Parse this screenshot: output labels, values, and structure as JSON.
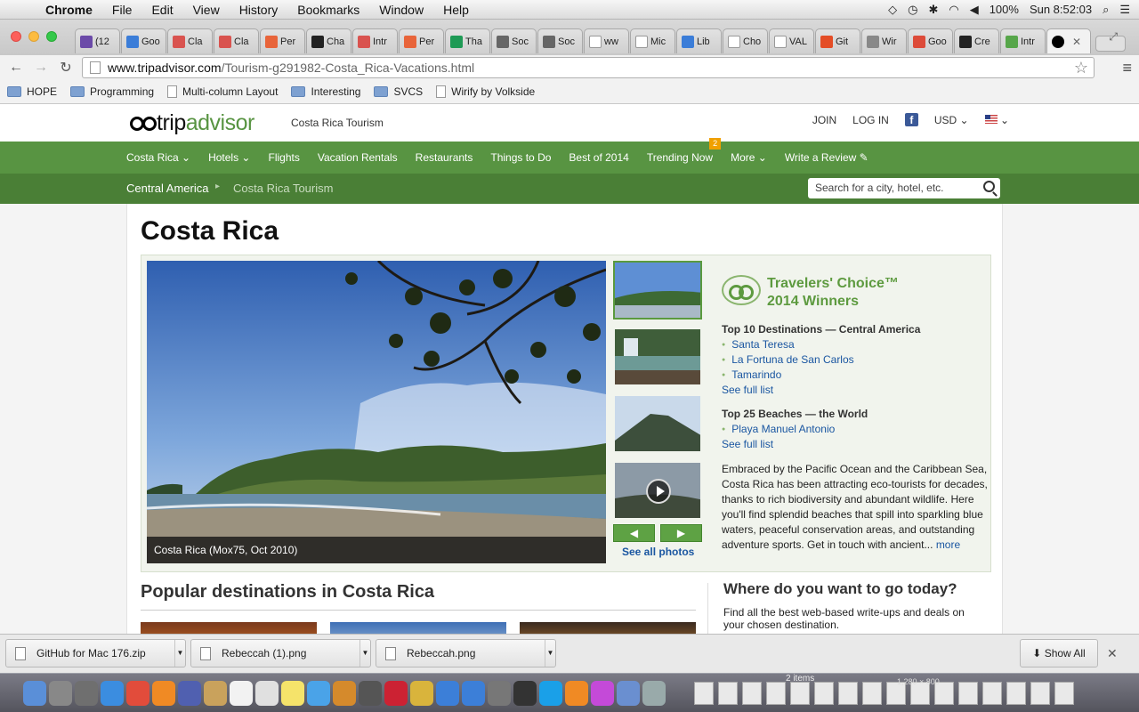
{
  "menubar": {
    "app": "Chrome",
    "items": [
      "File",
      "Edit",
      "View",
      "History",
      "Bookmarks",
      "Window",
      "Help"
    ],
    "battery": "100%",
    "clock": "Sun 8:52:03"
  },
  "tabs": [
    {
      "label": "(12",
      "color": "#6b4aa8"
    },
    {
      "label": "Goo",
      "color": "#3b7dd8"
    },
    {
      "label": "Cla",
      "color": "#d9534f"
    },
    {
      "label": "Cla",
      "color": "#d9534f"
    },
    {
      "label": "Per",
      "color": "#e8643a"
    },
    {
      "label": "Cha",
      "color": "#222222"
    },
    {
      "label": "Intr",
      "color": "#d9534f"
    },
    {
      "label": "Per",
      "color": "#e8643a"
    },
    {
      "label": "Tha",
      "color": "#1e9a55"
    },
    {
      "label": "Soc",
      "color": "#666666"
    },
    {
      "label": "Soc",
      "color": "#666666"
    },
    {
      "label": "ww",
      "color": "#ffffff"
    },
    {
      "label": "Mic",
      "color": "#ffffff"
    },
    {
      "label": "Lib",
      "color": "#3b7dd8"
    },
    {
      "label": "Cho",
      "color": "#ffffff"
    },
    {
      "label": "VAL",
      "color": "#ffffff"
    },
    {
      "label": "Git",
      "color": "#e44d26"
    },
    {
      "label": "Wir",
      "color": "#888888"
    },
    {
      "label": "Goo",
      "color": "#dd4b39"
    },
    {
      "label": "Cre",
      "color": "#222222"
    },
    {
      "label": "Intr",
      "color": "#57a64a"
    }
  ],
  "address": {
    "host": "www.tripadvisor.com",
    "path": "/Tourism-g291982-Costa_Rica-Vacations.html"
  },
  "bookmarks": [
    {
      "label": "HOPE",
      "type": "folder"
    },
    {
      "label": "Programming",
      "type": "folder"
    },
    {
      "label": "Multi-column Layout",
      "type": "page"
    },
    {
      "label": "Interesting",
      "type": "folder"
    },
    {
      "label": "SVCS",
      "type": "folder"
    },
    {
      "label": "Wirify by Volkside",
      "type": "page"
    }
  ],
  "site": {
    "logo_trip": "trip",
    "logo_advisor": "advisor",
    "subtitle": "Costa Rica Tourism",
    "join": "JOIN",
    "login": "LOG IN",
    "currency": "USD",
    "nav": [
      "Costa Rica",
      "Hotels",
      "Flights",
      "Vacation Rentals",
      "Restaurants",
      "Things to Do",
      "Best of 2014",
      "Trending Now",
      "More",
      "Write a Review"
    ],
    "trending_badge": "2",
    "breadcrumb_parent": "Central America",
    "breadcrumb_current": "Costa Rica Tourism",
    "search_placeholder": "Search for a city, hotel, etc.",
    "page_title": "Costa Rica",
    "photo_caption": "Costa Rica (Mox75, Oct 2010)",
    "see_all_photos": "See all photos",
    "tc_title_1": "Travelers' Choice™",
    "tc_title_2": "2014 Winners",
    "tc_section1": "Top 10 Destinations — Central America",
    "tc_list1": [
      "Santa Teresa",
      "La Fortuna de San Carlos",
      "Tamarindo"
    ],
    "see_full_list": "See full list",
    "tc_section2": "Top 25 Beaches — the World",
    "tc_list2": [
      "Playa Manuel Antonio"
    ],
    "description": "Embraced by the Pacific Ocean and the Caribbean Sea, Costa Rica has been attracting eco-tourists for decades, thanks to rich biodiversity and abundant wildlife. Here you'll find splendid beaches that spill into sparkling blue waters, peaceful conservation areas, and outstanding adventure sports. Get in touch with ancient...",
    "more": "more",
    "popular_title": "Popular destinations in Costa Rica",
    "where_title": "Where do you want to go today?",
    "where_text": "Find all the best web-based write-ups and deals on your chosen destination."
  },
  "downloads": {
    "files": [
      "GitHub for Mac 176.zip",
      "Rebeccah (1).png",
      "Rebeccah.png"
    ],
    "show_all": "Show All"
  },
  "dock": {
    "items_label": "2 items",
    "size_label": "1,280 × 800"
  }
}
